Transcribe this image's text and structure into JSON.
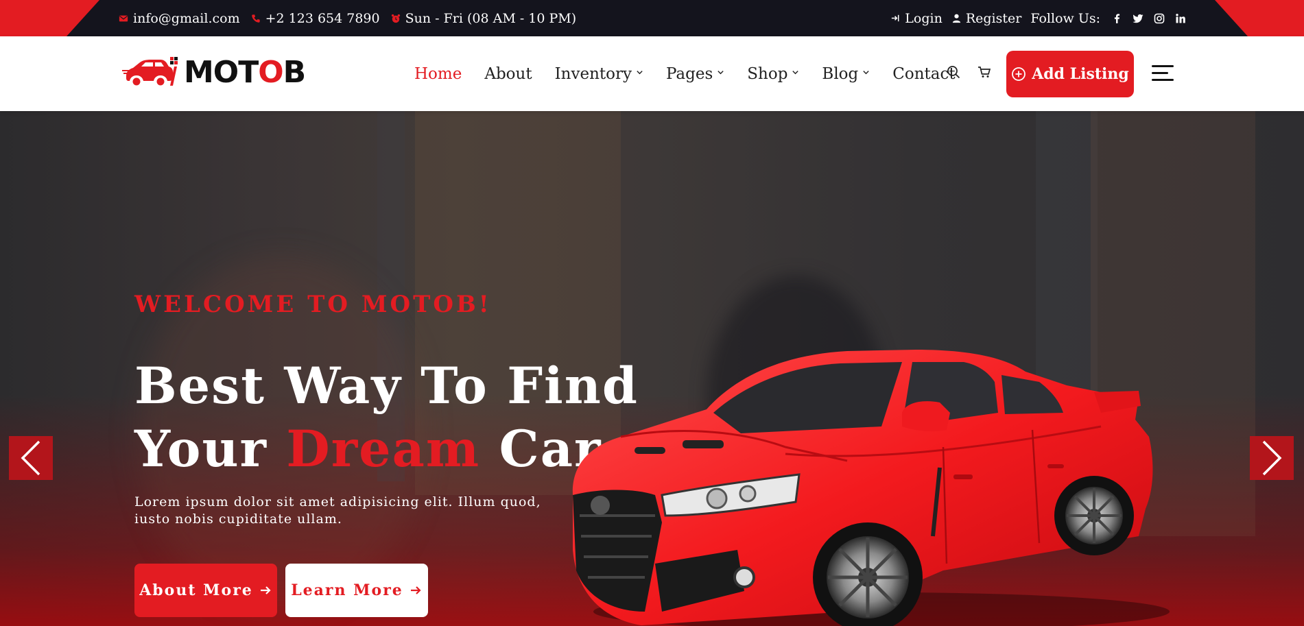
{
  "topbar": {
    "email": "info@gmail.com",
    "phone": "+2 123 654 7890",
    "hours": "Sun - Fri (08 AM - 10 PM)",
    "login": "Login",
    "register": "Register",
    "follow_us": "Follow Us:",
    "social_icons": [
      "facebook-icon",
      "twitter-icon",
      "instagram-icon",
      "linkedin-icon"
    ]
  },
  "header": {
    "logo_text_pre": "MOT",
    "logo_text_o": "O",
    "logo_text_post": "B",
    "nav": [
      {
        "label": "Home",
        "active": true,
        "dropdown": false
      },
      {
        "label": "About",
        "active": false,
        "dropdown": false
      },
      {
        "label": "Inventory",
        "active": false,
        "dropdown": true
      },
      {
        "label": "Pages",
        "active": false,
        "dropdown": true
      },
      {
        "label": "Shop",
        "active": false,
        "dropdown": true
      },
      {
        "label": "Blog",
        "active": false,
        "dropdown": true
      },
      {
        "label": "Contact",
        "active": false,
        "dropdown": false
      }
    ],
    "add_listing": "Add Listing"
  },
  "hero": {
    "welcome": "WELCOME TO MOTOB!",
    "headline_line1": "Best Way To Find",
    "headline_line2_pre": "Your ",
    "headline_line2_red": "Dream",
    "headline_line2_post": " Car",
    "description": "Lorem ipsum dolor sit amet adipisicing elit. Illum quod, iusto nobis cupiditate ullam.",
    "btn_about": "About More",
    "btn_learn": "Learn More"
  },
  "colors": {
    "accent": "#e31c22",
    "topbar_bg": "#14141d",
    "text_dark": "#222222"
  }
}
